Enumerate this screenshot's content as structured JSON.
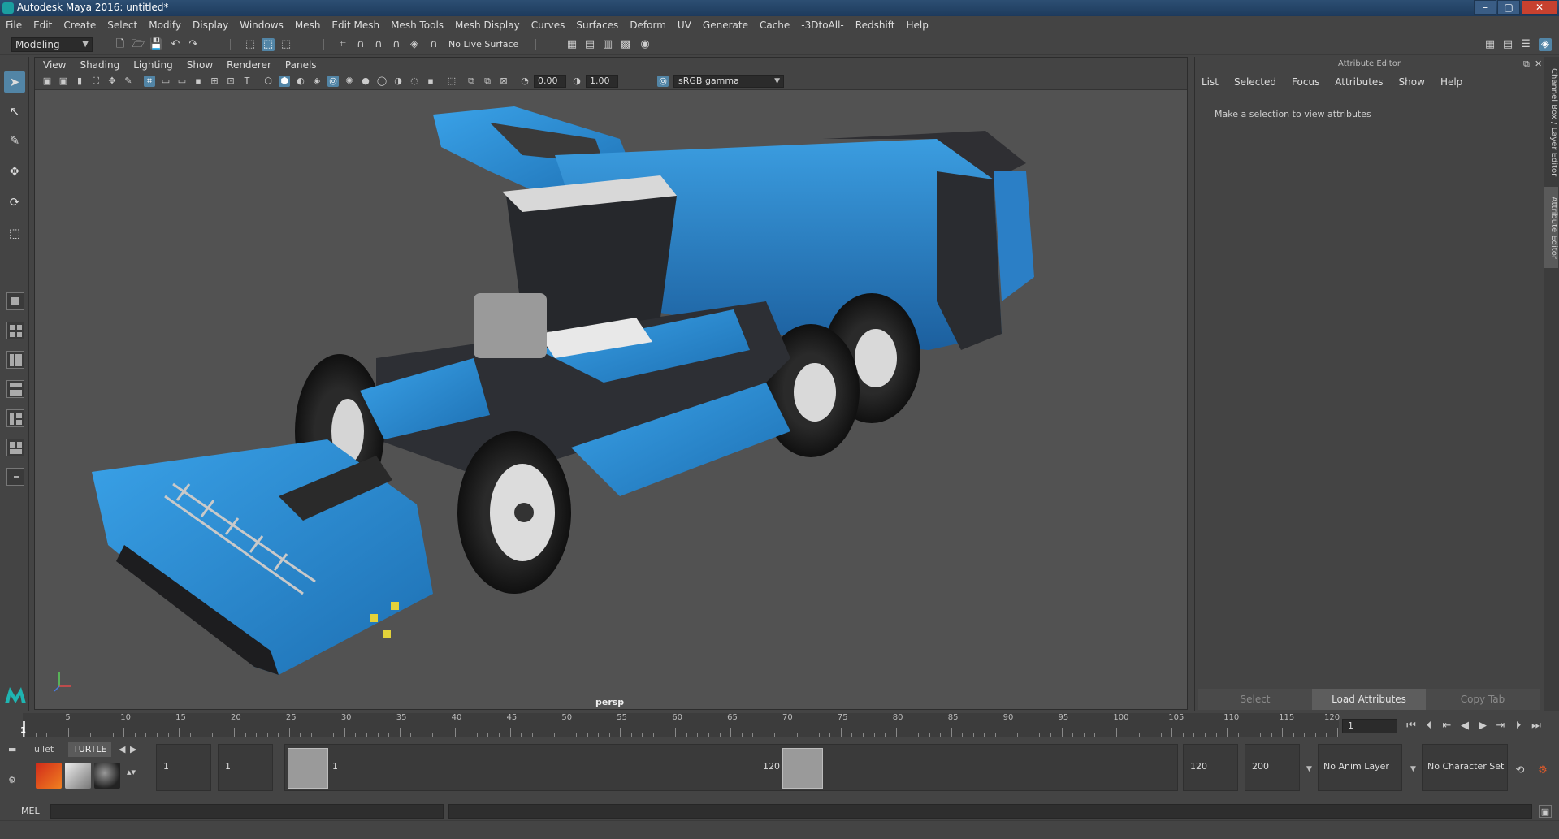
{
  "window": {
    "title": "Autodesk Maya 2016: untitled*",
    "controls": {
      "minimize": "–",
      "maximize": "▢",
      "close": "✕"
    }
  },
  "menu": [
    "File",
    "Edit",
    "Create",
    "Select",
    "Modify",
    "Display",
    "Windows",
    "Mesh",
    "Edit Mesh",
    "Mesh Tools",
    "Mesh Display",
    "Curves",
    "Surfaces",
    "Deform",
    "UV",
    "Generate",
    "Cache",
    "-3DtoAll-",
    "Redshift",
    "Help"
  ],
  "status_line": {
    "mode": "Modeling",
    "live_surface": "No Live Surface"
  },
  "viewport": {
    "panel_menu": [
      "View",
      "Shading",
      "Lighting",
      "Show",
      "Renderer",
      "Panels"
    ],
    "exposure": "0.00",
    "gamma_value": "1.00",
    "color_space": "sRGB gamma",
    "camera": "persp"
  },
  "attribute_editor": {
    "title": "Attribute Editor",
    "menu": [
      "List",
      "Selected",
      "Focus",
      "Attributes",
      "Show",
      "Help"
    ],
    "message": "Make a selection to view attributes",
    "buttons": {
      "select": "Select",
      "load": "Load Attributes",
      "copy": "Copy Tab"
    }
  },
  "side_tabs": {
    "channel_box": "Channel Box / Layer Editor",
    "attribute_editor": "Attribute Editor"
  },
  "timeline": {
    "labels": [
      "5",
      "10",
      "15",
      "20",
      "25",
      "30",
      "35",
      "40",
      "45",
      "50",
      "55",
      "60",
      "65",
      "70",
      "75",
      "80",
      "85",
      "90",
      "95",
      "100",
      "105",
      "110",
      "115",
      "120"
    ],
    "start": 1,
    "end": 120,
    "current_label": "1",
    "current_frame": "1"
  },
  "range": {
    "shelf_tabs": [
      "ullet",
      "TURTLE"
    ],
    "start": "1",
    "playback_start": "1",
    "handle_start": "1",
    "handle_end": "120",
    "playback_end": "120",
    "end": "200",
    "anim_layer": "No Anim Layer",
    "character_set": "No Character Set"
  },
  "command_line": {
    "language": "MEL"
  },
  "colors": {
    "accent": "#5285a6",
    "machine_blue": "#2f8fd6",
    "viewport_bg": "#525252"
  }
}
